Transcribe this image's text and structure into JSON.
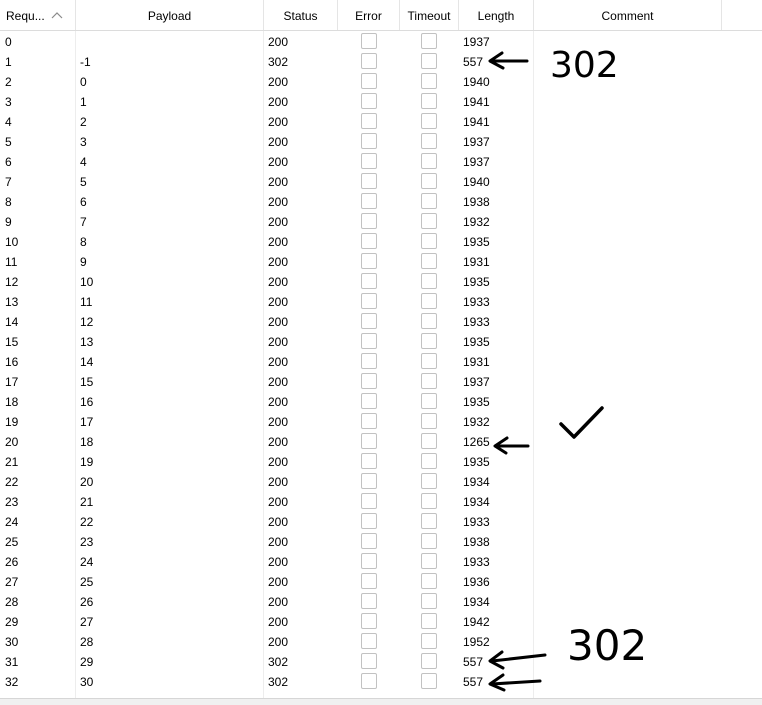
{
  "columns": {
    "request": "Requ...",
    "payload": "Payload",
    "status": "Status",
    "error": "Error",
    "timeout": "Timeout",
    "length": "Length",
    "comment": "Comment"
  },
  "sort": {
    "column": "request",
    "direction": "ascending",
    "icon": "sort-up-icon"
  },
  "rows": [
    {
      "request": "0",
      "payload": "",
      "status": "200",
      "error": false,
      "timeout": false,
      "length": "1937",
      "comment": ""
    },
    {
      "request": "1",
      "payload": "-1",
      "status": "302",
      "error": false,
      "timeout": false,
      "length": "557",
      "comment": ""
    },
    {
      "request": "2",
      "payload": "0",
      "status": "200",
      "error": false,
      "timeout": false,
      "length": "1940",
      "comment": ""
    },
    {
      "request": "3",
      "payload": "1",
      "status": "200",
      "error": false,
      "timeout": false,
      "length": "1941",
      "comment": ""
    },
    {
      "request": "4",
      "payload": "2",
      "status": "200",
      "error": false,
      "timeout": false,
      "length": "1941",
      "comment": ""
    },
    {
      "request": "5",
      "payload": "3",
      "status": "200",
      "error": false,
      "timeout": false,
      "length": "1937",
      "comment": ""
    },
    {
      "request": "6",
      "payload": "4",
      "status": "200",
      "error": false,
      "timeout": false,
      "length": "1937",
      "comment": ""
    },
    {
      "request": "7",
      "payload": "5",
      "status": "200",
      "error": false,
      "timeout": false,
      "length": "1940",
      "comment": ""
    },
    {
      "request": "8",
      "payload": "6",
      "status": "200",
      "error": false,
      "timeout": false,
      "length": "1938",
      "comment": ""
    },
    {
      "request": "9",
      "payload": "7",
      "status": "200",
      "error": false,
      "timeout": false,
      "length": "1932",
      "comment": ""
    },
    {
      "request": "10",
      "payload": "8",
      "status": "200",
      "error": false,
      "timeout": false,
      "length": "1935",
      "comment": ""
    },
    {
      "request": "11",
      "payload": "9",
      "status": "200",
      "error": false,
      "timeout": false,
      "length": "1931",
      "comment": ""
    },
    {
      "request": "12",
      "payload": "10",
      "status": "200",
      "error": false,
      "timeout": false,
      "length": "1935",
      "comment": ""
    },
    {
      "request": "13",
      "payload": "11",
      "status": "200",
      "error": false,
      "timeout": false,
      "length": "1933",
      "comment": ""
    },
    {
      "request": "14",
      "payload": "12",
      "status": "200",
      "error": false,
      "timeout": false,
      "length": "1933",
      "comment": ""
    },
    {
      "request": "15",
      "payload": "13",
      "status": "200",
      "error": false,
      "timeout": false,
      "length": "1935",
      "comment": ""
    },
    {
      "request": "16",
      "payload": "14",
      "status": "200",
      "error": false,
      "timeout": false,
      "length": "1931",
      "comment": ""
    },
    {
      "request": "17",
      "payload": "15",
      "status": "200",
      "error": false,
      "timeout": false,
      "length": "1937",
      "comment": ""
    },
    {
      "request": "18",
      "payload": "16",
      "status": "200",
      "error": false,
      "timeout": false,
      "length": "1935",
      "comment": ""
    },
    {
      "request": "19",
      "payload": "17",
      "status": "200",
      "error": false,
      "timeout": false,
      "length": "1932",
      "comment": ""
    },
    {
      "request": "20",
      "payload": "18",
      "status": "200",
      "error": false,
      "timeout": false,
      "length": "1265",
      "comment": ""
    },
    {
      "request": "21",
      "payload": "19",
      "status": "200",
      "error": false,
      "timeout": false,
      "length": "1935",
      "comment": ""
    },
    {
      "request": "22",
      "payload": "20",
      "status": "200",
      "error": false,
      "timeout": false,
      "length": "1934",
      "comment": ""
    },
    {
      "request": "23",
      "payload": "21",
      "status": "200",
      "error": false,
      "timeout": false,
      "length": "1934",
      "comment": ""
    },
    {
      "request": "24",
      "payload": "22",
      "status": "200",
      "error": false,
      "timeout": false,
      "length": "1933",
      "comment": ""
    },
    {
      "request": "25",
      "payload": "23",
      "status": "200",
      "error": false,
      "timeout": false,
      "length": "1938",
      "comment": ""
    },
    {
      "request": "26",
      "payload": "24",
      "status": "200",
      "error": false,
      "timeout": false,
      "length": "1933",
      "comment": ""
    },
    {
      "request": "27",
      "payload": "25",
      "status": "200",
      "error": false,
      "timeout": false,
      "length": "1936",
      "comment": ""
    },
    {
      "request": "28",
      "payload": "26",
      "status": "200",
      "error": false,
      "timeout": false,
      "length": "1934",
      "comment": ""
    },
    {
      "request": "29",
      "payload": "27",
      "status": "200",
      "error": false,
      "timeout": false,
      "length": "1942",
      "comment": ""
    },
    {
      "request": "30",
      "payload": "28",
      "status": "200",
      "error": false,
      "timeout": false,
      "length": "1952",
      "comment": ""
    },
    {
      "request": "31",
      "payload": "29",
      "status": "302",
      "error": false,
      "timeout": false,
      "length": "557",
      "comment": ""
    },
    {
      "request": "32",
      "payload": "30",
      "status": "302",
      "error": false,
      "timeout": false,
      "length": "557",
      "comment": ""
    }
  ],
  "annotations": {
    "note_top": "302",
    "note_bottom": "302",
    "ink_color": "#000000",
    "icons": [
      "arrow-left-icon",
      "checkmark-icon"
    ]
  },
  "colors": {
    "grid_line": "#ededed",
    "header_border": "#dcdcdc",
    "checkbox_border": "#c2c2c2"
  }
}
